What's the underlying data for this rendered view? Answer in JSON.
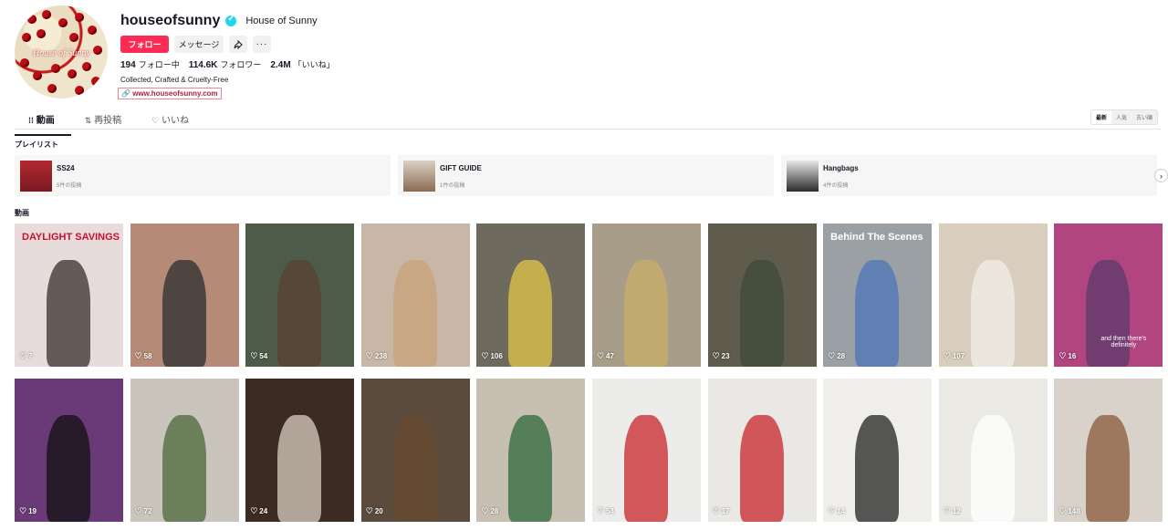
{
  "profile": {
    "username": "houseofsunny",
    "nickname": "House of Sunny",
    "avatar_text": "House of Sunny",
    "follow_label": "フォロー",
    "message_label": "メッセージ",
    "following_count": "194",
    "following_label": "フォロー中",
    "followers_count": "114.6K",
    "followers_label": "フォロワー",
    "likes_count": "2.4M",
    "likes_label": "「いいね」",
    "bio": "Collected, Crafted & Cruelty-Free",
    "link": "www.houseofsunny.com"
  },
  "tabs": [
    {
      "label": "動画",
      "icon": "grid-icon"
    },
    {
      "label": "再投稿",
      "icon": "repost-icon"
    },
    {
      "label": "いいね",
      "icon": "heart-outline-icon"
    }
  ],
  "sort": [
    "最新",
    "人気",
    "古い順"
  ],
  "playlist_heading": "プレイリスト",
  "playlists": [
    {
      "title": "SS24",
      "count": "5件の投稿"
    },
    {
      "title": "GIFT GUIDE",
      "count": "1件の投稿"
    },
    {
      "title": "Hangbags",
      "count": "4件の投稿"
    }
  ],
  "videos_heading": "動画",
  "videos": [
    {
      "likes": "7",
      "bg": "#e7dbdc",
      "overlay": "DAYLIGHT SAVINGS"
    },
    {
      "likes": "58",
      "bg": "#b58b77"
    },
    {
      "likes": "54",
      "bg": "#4c5c48"
    },
    {
      "likes": "238",
      "bg": "#c8b7a6"
    },
    {
      "likes": "106",
      "bg": "#6e6a5e"
    },
    {
      "likes": "47",
      "bg": "#a89d88"
    },
    {
      "likes": "23",
      "bg": "#5f5b4d"
    },
    {
      "likes": "28",
      "bg": "#9aa0a3",
      "overlay": "Behind The Scenes"
    },
    {
      "likes": "107",
      "bg": "#d9cdbd"
    },
    {
      "likes": "16",
      "bg": "#b1457f",
      "caption": "and then there's definitely"
    },
    {
      "likes": "19",
      "bg": "#6a3a78"
    },
    {
      "likes": "72",
      "bg": "#c9c4bc"
    },
    {
      "likes": "24",
      "bg": "#3b2b23"
    },
    {
      "likes": "20",
      "bg": "#5a4b3d"
    },
    {
      "likes": "28",
      "bg": "#c7c0b2"
    },
    {
      "likes": "54",
      "bg": "#ececea"
    },
    {
      "likes": "17",
      "bg": "#eae8e5"
    },
    {
      "likes": "14",
      "bg": "#f0eeeb"
    },
    {
      "likes": "12",
      "bg": "#ebe9e3"
    },
    {
      "likes": "148",
      "bg": "#d8d2ca"
    }
  ],
  "colors": {
    "accent": "#fe2c55",
    "verified": "#20d5ec",
    "text": "#161823"
  }
}
